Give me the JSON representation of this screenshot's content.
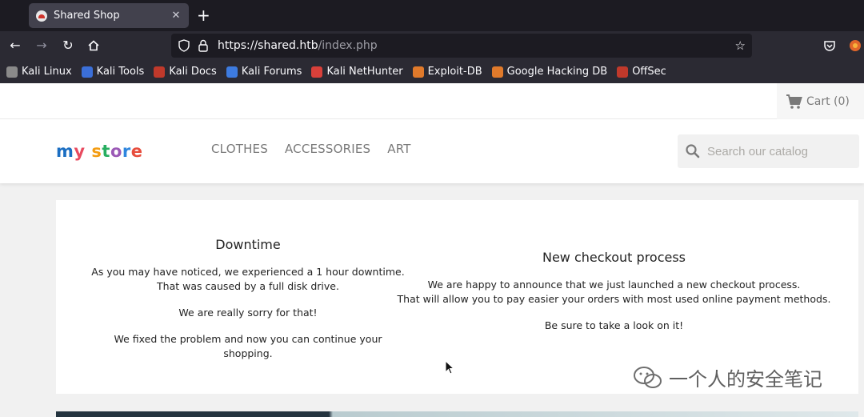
{
  "browser": {
    "tab_title": "Shared Shop",
    "tab_close": "✕",
    "new_tab": "+",
    "url_host": "https://shared.htb",
    "url_path": "/index.php",
    "bookmarks": [
      {
        "label": "Kali Linux",
        "color": "#8a8a8a"
      },
      {
        "label": "Kali Tools",
        "color": "#3b6fd8"
      },
      {
        "label": "Kali Docs",
        "color": "#c0392b"
      },
      {
        "label": "Kali Forums",
        "color": "#3d7be0"
      },
      {
        "label": "Kali NetHunter",
        "color": "#d8403a"
      },
      {
        "label": "Exploit-DB",
        "color": "#e07a2b"
      },
      {
        "label": "Google Hacking DB",
        "color": "#e07a2b"
      },
      {
        "label": "OffSec",
        "color": "#c0392b"
      }
    ]
  },
  "store": {
    "cart_label": "Cart (0)",
    "logo": {
      "m": "m",
      "y": "y",
      "space": " ",
      "s": "s",
      "t": "t",
      "o": "o",
      "r": "r",
      "e": "e"
    },
    "menu": [
      "CLOTHES",
      "ACCESSORIES",
      "ART"
    ],
    "search_placeholder": "Search our catalog"
  },
  "announcements": [
    {
      "title": "Downtime",
      "paragraphs": [
        [
          "As you may have noticed, we experienced a 1 hour downtime.",
          "That was caused by a full disk drive."
        ],
        [
          "We are really sorry for that!"
        ],
        [
          "We fixed the problem and now you can continue your shopping."
        ]
      ]
    },
    {
      "title": "New checkout process",
      "paragraphs": [
        [
          "We are happy to announce that we just launched a new checkout process.",
          "That will allow you to pay easier your orders with most used online payment methods."
        ],
        [
          "Be sure to take a look on it!"
        ]
      ]
    }
  ],
  "watermark": "一个人的安全笔记"
}
